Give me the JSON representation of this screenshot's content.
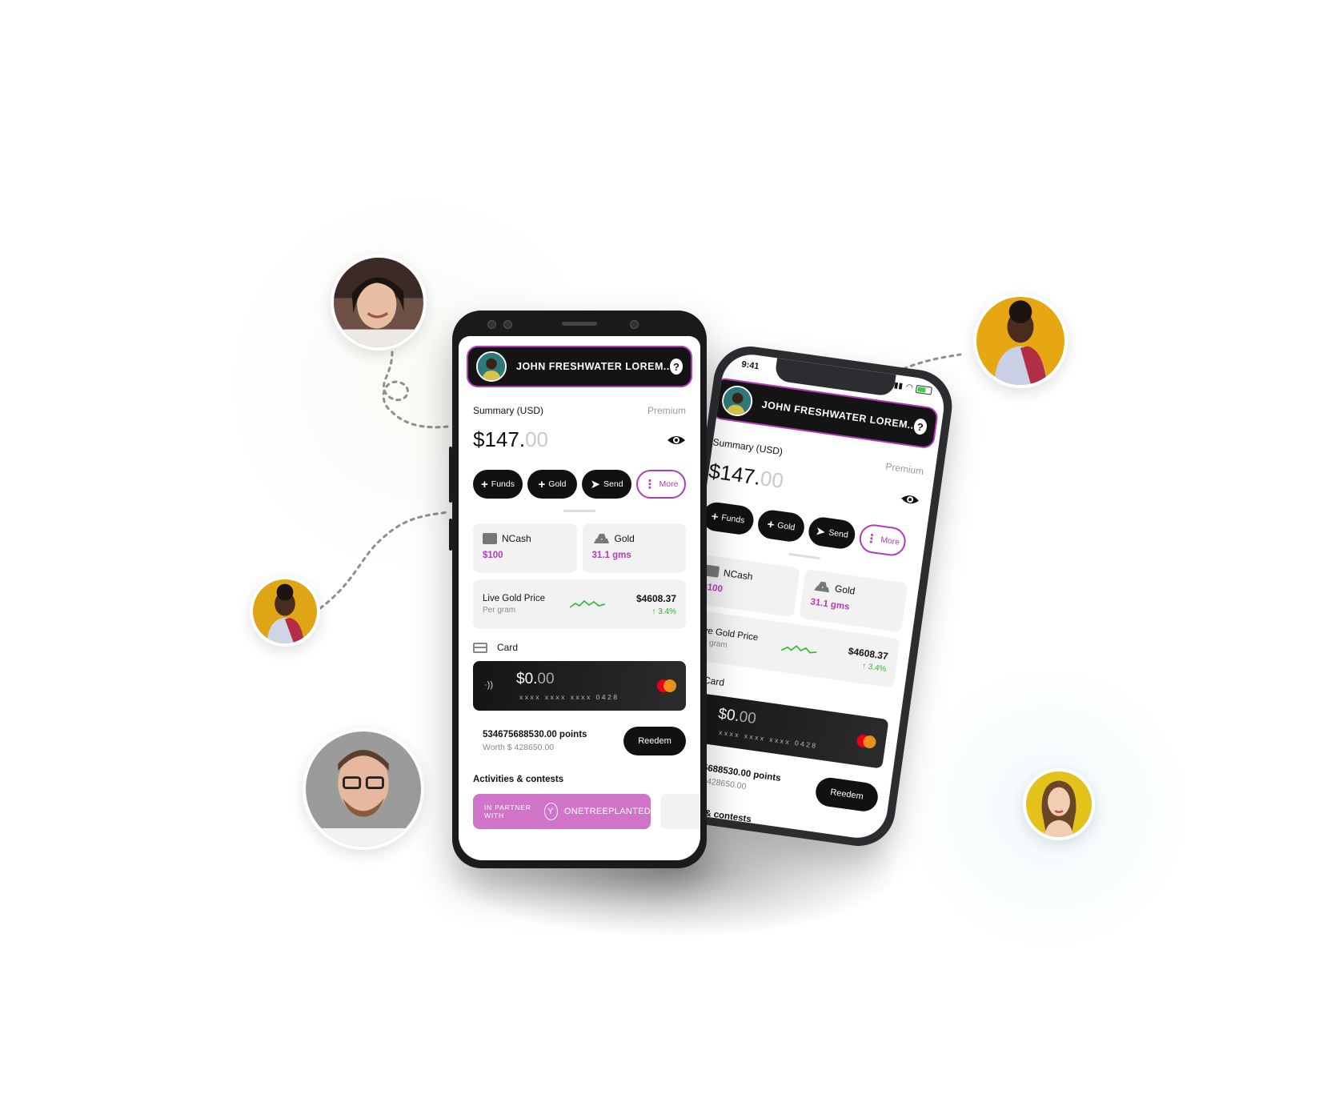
{
  "profile": {
    "name": "JOHN FRESHWATER LOREM..",
    "help_glyph": "?"
  },
  "summary": {
    "label": "Summary (USD)",
    "tier": "Premium",
    "balance_main": "$147.",
    "balance_cents": "00"
  },
  "actions": [
    {
      "glyph": "+",
      "label": "Funds"
    },
    {
      "glyph": "+",
      "label": "Gold"
    },
    {
      "glyph": "➤",
      "label": "Send"
    },
    {
      "glyph": "⋮",
      "label": "More"
    }
  ],
  "tiles": [
    {
      "label": "NCash",
      "value": "$100",
      "icon": "wallet-icon"
    },
    {
      "label": "Gold",
      "value": "31.1 gms",
      "icon": "gold-bars-icon"
    }
  ],
  "gold_price": {
    "label": "Live Gold Price",
    "sub": "Per gram",
    "value": "$4608.37",
    "change": "↑ 3.4%"
  },
  "card": {
    "header": "Card",
    "balance_main": "$0.",
    "balance_cents": "00",
    "number": "xxxx xxxx xxxx 0428",
    "nfc_glyph": "·))"
  },
  "points": {
    "value": "534675688530.00 points",
    "worth": "Worth $ 428650.00",
    "redeem_label": "Reedem"
  },
  "activities": {
    "header": "Activities & contests",
    "promo_prefix": "IN PARTNER WITH",
    "promo_brand": "ONETREEPLANTED"
  },
  "back_phone": {
    "time": "9:41"
  },
  "colors": {
    "accent": "#b43bb8",
    "dark": "#111111",
    "positive": "#2eb82e",
    "promo": "#cf74c8"
  }
}
